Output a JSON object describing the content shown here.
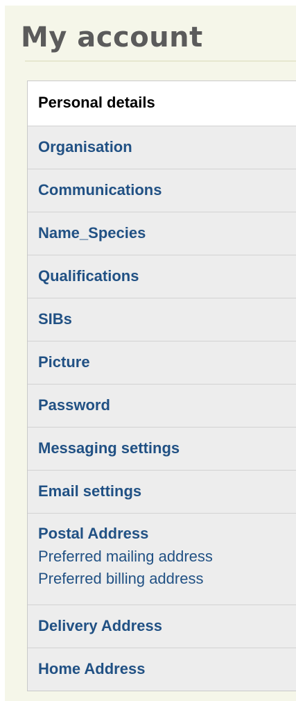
{
  "page": {
    "title": "My account"
  },
  "nav": {
    "items": [
      {
        "label": "Personal details",
        "active": true
      },
      {
        "label": "Organisation"
      },
      {
        "label": "Communications"
      },
      {
        "label": "Name_Species"
      },
      {
        "label": "Qualifications"
      },
      {
        "label": "SIBs"
      },
      {
        "label": "Picture"
      },
      {
        "label": "Password"
      },
      {
        "label": "Messaging settings"
      },
      {
        "label": "Email settings"
      },
      {
        "label": "Postal Address",
        "sub_links": [
          "Preferred mailing address",
          "Preferred billing address"
        ]
      },
      {
        "label": "Delivery Address"
      },
      {
        "label": "Home Address"
      }
    ]
  },
  "colors": {
    "panel_background": "#f5f6e9",
    "item_background": "#ededed",
    "active_background": "#ffffff",
    "link": "#215184",
    "title": "#5b5b5b"
  }
}
